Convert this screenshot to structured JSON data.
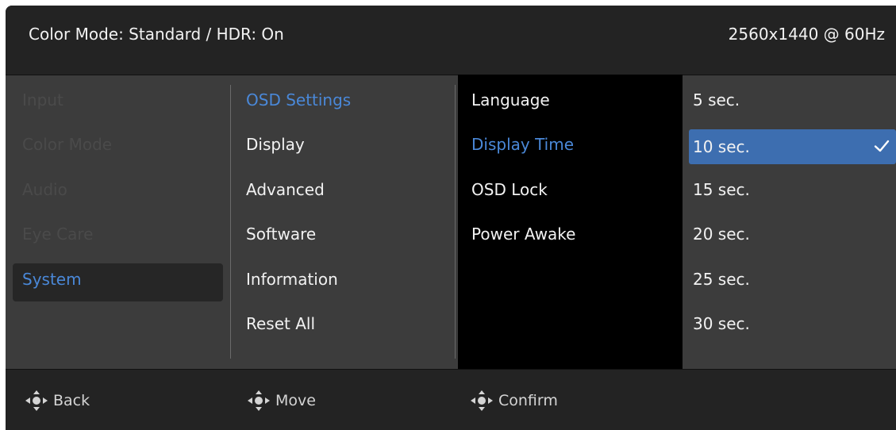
{
  "header": {
    "title": "Color Mode: Standard / HDR: On",
    "resolution": "2560x1440 @ 60Hz"
  },
  "menu": {
    "categories": [
      "Input",
      "Color Mode",
      "Audio",
      "Eye Care",
      "System"
    ],
    "selected_category": "System",
    "submenu": [
      "OSD Settings",
      "Display",
      "Advanced",
      "Software",
      "Information",
      "Reset All"
    ],
    "selected_submenu": "OSD Settings",
    "options": [
      "Language",
      "Display Time",
      "OSD Lock",
      "Power Awake"
    ],
    "selected_option": "Display Time",
    "values": [
      "5 sec.",
      "10 sec.",
      "15 sec.",
      "20 sec.",
      "25 sec.",
      "30 sec."
    ],
    "selected_value": "10 sec."
  },
  "footer": {
    "back_label": "Back",
    "move_label": "Move",
    "confirm_label": "Confirm"
  },
  "colors": {
    "accent": "#4a88d8",
    "selection": "#3d6eb0",
    "disabled_text": "#4a4a4a",
    "background": "#3c3c3c",
    "bar_background": "#232323"
  },
  "icons": {
    "joystick": "joystick-icon",
    "checkmark": "checkmark-icon"
  }
}
